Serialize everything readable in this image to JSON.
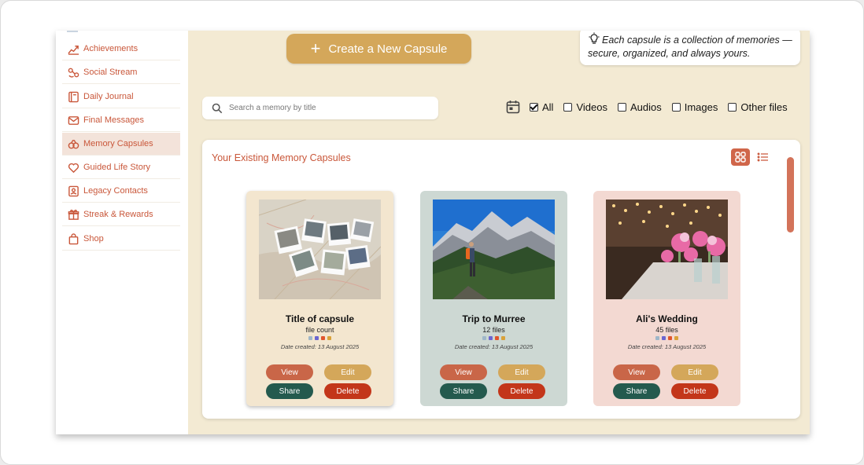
{
  "sidebar": {
    "items": [
      {
        "label": "Achievements",
        "icon": "chart-line-icon"
      },
      {
        "label": "Social Stream",
        "icon": "share-nodes-icon"
      },
      {
        "label": "Daily Journal",
        "icon": "journal-icon"
      },
      {
        "label": "Final Messages",
        "icon": "envelope-icon"
      },
      {
        "label": "Memory Capsules",
        "icon": "capsules-icon"
      },
      {
        "label": "Guided Life Story",
        "icon": "heart-icon"
      },
      {
        "label": "Legacy Contacts",
        "icon": "contact-card-icon"
      },
      {
        "label": "Streak & Rewards",
        "icon": "gift-icon"
      },
      {
        "label": "Shop",
        "icon": "shopping-bag-icon"
      }
    ],
    "active": "Memory Capsules"
  },
  "header": {
    "create_label": "Create a New Capsule",
    "create_icon": "plus-icon",
    "tip_text": "Each capsule is a collection of memories — secure, organized, and always yours.",
    "tip_icon": "lightbulb-icon"
  },
  "search": {
    "placeholder": "Search a memory by title",
    "value": ""
  },
  "filters": {
    "calendar_icon": "calendar-icon",
    "options": [
      {
        "label": "All",
        "checked": true
      },
      {
        "label": "Videos",
        "checked": false
      },
      {
        "label": "Audios",
        "checked": false
      },
      {
        "label": "Images",
        "checked": false
      },
      {
        "label": "Other files",
        "checked": false
      }
    ]
  },
  "panel": {
    "title": "Your Existing Memory Capsules",
    "view_mode": "grid"
  },
  "capsules": [
    {
      "title": "Title of capsule",
      "count": "file count",
      "date": "Date created: 13 August 2025",
      "bg": "#f3e6cf",
      "photo": "polaroids-on-map"
    },
    {
      "title": "Trip to Murree",
      "count": "12 files",
      "date": "Date created: 13 August 2025",
      "bg": "#cdd8d3",
      "photo": "hiker-mountains"
    },
    {
      "title": "Ali's Wedding",
      "count": "45 files",
      "date": "Date created: 13 August 2025",
      "bg": "#f3d9d2",
      "photo": "wedding-flowers"
    }
  ],
  "card_actions": {
    "view": "View",
    "edit": "Edit",
    "share": "Share",
    "delete": "Delete"
  },
  "colors": {
    "accent": "#c9573a",
    "gold": "#d4a75a",
    "teal": "#245a4e",
    "danger": "#c3361a",
    "background": "#f3ead3"
  }
}
